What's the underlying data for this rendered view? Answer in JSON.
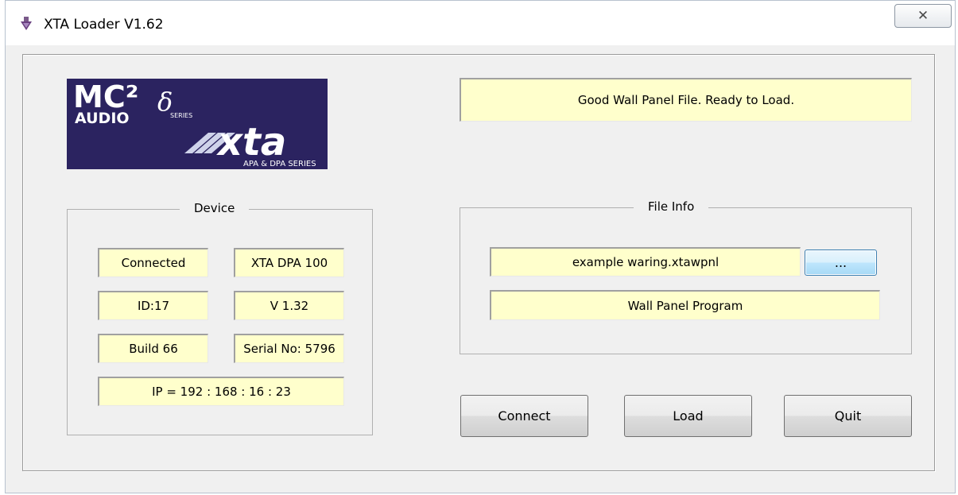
{
  "window": {
    "title": "XTA Loader V1.62",
    "app_icon": "xta-app-icon",
    "close_glyph": "✕"
  },
  "logo": {
    "brand_top": "MC²",
    "brand_bottom": "AUDIO",
    "delta": "δ",
    "series_small": "SERIES",
    "xta": "xta",
    "subtitle": "APA & DPA SERIES"
  },
  "status": {
    "message": "Good Wall Panel File. Ready to Load."
  },
  "device": {
    "label": "Device",
    "connection": "Connected",
    "model": "XTA DPA 100",
    "id": "ID:17",
    "version": "V 1.32",
    "build": "Build 66",
    "serial": "Serial No: 5796",
    "ip": "IP = 192 : 168 : 16 : 23"
  },
  "file_info": {
    "label": "File Info",
    "filename": "example waring.xtawpnl",
    "browse_label": "...",
    "type": "Wall Panel Program"
  },
  "buttons": {
    "connect": "Connect",
    "load": "Load",
    "quit": "Quit"
  },
  "colors": {
    "field_bg": "#ffffcc",
    "logo_bg": "#2b2360"
  }
}
